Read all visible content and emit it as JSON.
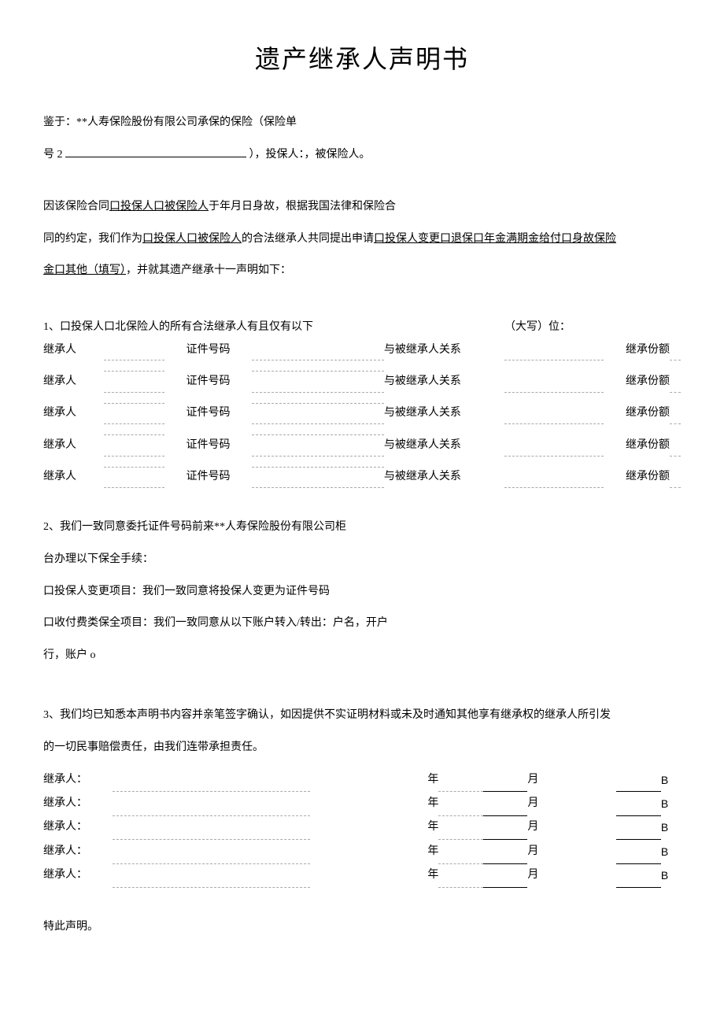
{
  "title": "遗产继承人声明书",
  "intro": {
    "line1": "鉴于：**人寿保险股份有限公司承保的保险（保险单",
    "line2_prefix": "号",
    "line2_num": "2",
    "line2_suffix": "），投保人：，被保险人。"
  },
  "p2": {
    "a": "因该保险合同",
    "b": "口投保人口被保险人",
    "c": "于年月日身故，根据我国法律和保险合"
  },
  "p3": {
    "a": "同的约定，我们作为",
    "b": "口投保人口被保险人",
    "c": "的合法继承人共同提出申请",
    "d": "口投保人变更口退保口年金满期金给付口身故保险"
  },
  "p4": {
    "a": "金口其他（填写）",
    "b": "，并就其遗产继承十一声明如下："
  },
  "sec1": {
    "intro_a": "1、口投保人口北保险人的所有合法继承人有且仅有以下",
    "intro_b": "（大写）位：",
    "heir_label": "继承人",
    "id_label": "证件号码",
    "rel_label": "与被继承人关系",
    "share_label": "继承份额"
  },
  "sec2": {
    "l1": "2、我们一致同意委托证件号码前来**人寿保险股份有限公司柜",
    "l2": "台办理以下保全手续：",
    "l3": "口投保人变更项目：我们一致同意将投保人变更为证件号码",
    "l4": "口收付费类保全项目：我们一致同意从以下账户转入/转出：户名，开户",
    "l5": "行，账户 o"
  },
  "sec3": {
    "l1": "3、我们均已知悉本声明书内容并亲笔签字确认，如因提供不实证明材料或未及时通知其他享有继承权的继承人所引发",
    "l2": "的一切民事赔偿责任，由我们连带承担责任。"
  },
  "sign": {
    "heir_label": "继承人：",
    "year": "年",
    "month": "月",
    "b": "B"
  },
  "footer": "特此声明。"
}
